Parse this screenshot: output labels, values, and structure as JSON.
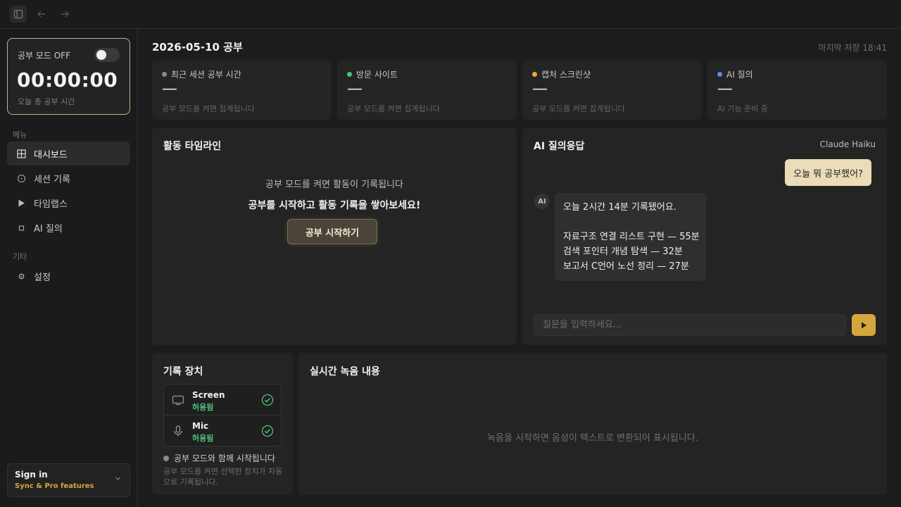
{
  "study_card": {
    "mode_label": "공부 모드 OFF",
    "timer": "00:00:00",
    "caption": "오늘 총 공부 시간"
  },
  "sidebar": {
    "menu_label": "메뉴",
    "items": [
      {
        "label": "대시보드",
        "icon": "grid-icon"
      },
      {
        "label": "세션 기록",
        "icon": "clock-icon"
      },
      {
        "label": "타임랩스",
        "icon": "play-icon"
      },
      {
        "label": "AI 질의",
        "icon": "square-icon"
      }
    ],
    "other_label": "기타",
    "settings_label": "설정"
  },
  "signin": {
    "title": "Sign in",
    "subtitle": "Sync & Pro features"
  },
  "header": {
    "title": "2026-05-10 공부",
    "saved_at": "마지막 저장 18:41"
  },
  "stats": [
    {
      "label": "최근 세션 공부 시간",
      "value": "—",
      "caption": "공부 모드를 켜면 집계됩니다",
      "dot_color": "#8a8a8a"
    },
    {
      "label": "방문 사이트",
      "value": "—",
      "caption": "공부 모드를 켜면 집계됩니다",
      "dot_color": "#4fc27a"
    },
    {
      "label": "캡처 스크린샷",
      "value": "—",
      "caption": "공부 모드를 켜면 집계됩니다",
      "dot_color": "#f0a843"
    },
    {
      "label": "AI 질의",
      "value": "—",
      "caption": "AI 기능 준비 중",
      "dot_color": "#5a8cf0"
    }
  ],
  "timeline": {
    "title": "활동 타임라인",
    "message": "공부 모드를 켜면 활동이 기록됩니다",
    "cta": "공부를 시작하고 활동 기록을 쌓아보세요!",
    "button_label": "공부 시작하기"
  },
  "ai": {
    "title": "AI 질의응답",
    "model": "Claude Haiku",
    "user_message": "오늘 뭐 공부했어?",
    "avatar_label": "AI",
    "response_lines": [
      "오늘 2시간 14분 기록됐어요.",
      "",
      "자료구조  연결 리스트 구현 — 55분",
      "검색  포인터 개념 탐색 — 32분",
      "보고서  C언어 노선 정리 — 27분"
    ],
    "input_placeholder": "질문을 입력하세요..."
  },
  "devices": {
    "title": "기록 장치",
    "items": [
      {
        "name": "Screen",
        "status": "허용됨"
      },
      {
        "name": "Mic",
        "status": "허용됨"
      }
    ],
    "note": "공부 모드와 함께 시작됩니다",
    "description": "공부 모드를 켜면 선택한 장치가 자동으로 기록됩니다."
  },
  "transcript": {
    "title": "실시간 녹음 내용",
    "empty": "녹음을 시작하면 음성이 텍스트로 변환되어 표시됩니다."
  },
  "colors": {
    "accent": "#d4a73c",
    "success": "#4fc27a",
    "card_border": "#bfb28a"
  }
}
